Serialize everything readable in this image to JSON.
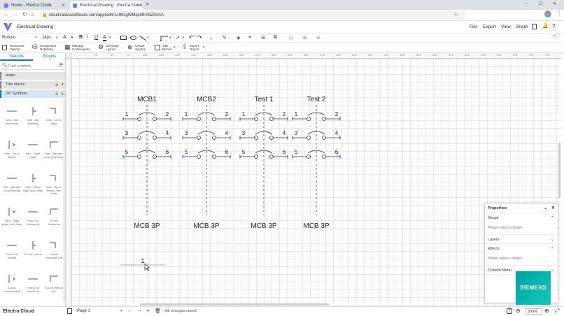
{
  "browser": {
    "tabs": [
      {
        "label": "Home - Electra Cloud",
        "active": false
      },
      {
        "label": "Electrical Drawing - Electra Cloud",
        "active": true
      }
    ],
    "url": "cloud.radicasoftware.com/app/edit/-LI9fGgWMqx09UMZh3XA"
  },
  "app": {
    "title": "Electrical Drawing",
    "menu": [
      "File",
      "Export",
      "View",
      "Share"
    ]
  },
  "format": {
    "font": "Roboto",
    "size": "14px",
    "bold": "B",
    "italic": "I",
    "underline": "U",
    "text_color": "A"
  },
  "ribbon": [
    {
      "line1": "Document",
      "line2": "Options"
    },
    {
      "line1": "Component",
      "line2": "Database"
    },
    {
      "line1": "Manage",
      "line2": "Components"
    },
    {
      "line1": "Generate",
      "line2": "Layout"
    },
    {
      "line1": "Create",
      "line2": "Symbol"
    },
    {
      "line1": "Title",
      "line2": "Blocks"
    },
    {
      "line1": "Export",
      "line2": "Report"
    }
  ],
  "sidebar": {
    "tabs": [
      "Stencils",
      "Plugins"
    ],
    "search_placeholder": "Find symbols",
    "sections": [
      "motor",
      "Title blocks",
      "JIC Symbols"
    ],
    "stencils": [
      "Wire - Mid (horizontal)",
      "Wire - Mid (vertical)",
      "Wire - Left to Right",
      "Wire - Top to Bottom",
      "Wire - Right Angle",
      "Wire - Mid with Jump (horizontal)",
      "Wire - Mid with Jump (vertical)",
      "Wire - Left to Right, with Jump",
      "Wire - Top to Bottom, with Jump",
      "Wire - Right angle, with Jump",
      "From Link Horizontal",
      "To Link Horizontal",
      "From Link Vertical",
      "To Link Vertical",
      "To Link Horizontal Left",
      "To Link Horizontal Left",
      "From Link Vertical Up",
      "To Link Vertical Up"
    ]
  },
  "ruler_labels": [
    "25",
    "50",
    "75",
    "100",
    "125",
    "150",
    "175",
    "200",
    "225",
    "250",
    "275",
    "300",
    "325",
    "350",
    "375",
    "400",
    "425",
    "450",
    "475",
    "500",
    "525",
    "550",
    "575",
    "600",
    "625",
    "650",
    "675",
    "700",
    "725",
    "750"
  ],
  "drawing": {
    "breakers": [
      {
        "name": "MCB1",
        "type": "MCB 3P"
      },
      {
        "name": "MCB2",
        "type": "MCB 3P"
      },
      {
        "name": "Test 1",
        "type": "MCB 3P"
      },
      {
        "name": "Test 2",
        "type": "MCB 3P"
      }
    ],
    "terminals": [
      [
        "1",
        "2"
      ],
      [
        "3",
        "4"
      ],
      [
        "5",
        "6"
      ]
    ],
    "wire_label": "1"
  },
  "properties": {
    "title": "Properties",
    "sections": [
      "Shape",
      "Layers",
      "Effects",
      "Custom Menu"
    ],
    "hint": "Please select a shape"
  },
  "status": {
    "brand": "Electra Cloud",
    "page": "Page 1",
    "saved": "All changes saved",
    "zoom": "300%",
    "logo": "SIEMENS"
  },
  "colors": {
    "accent": "#1a73c9",
    "siemens": "#00a0a0",
    "terminal": "#2d6dd6"
  }
}
